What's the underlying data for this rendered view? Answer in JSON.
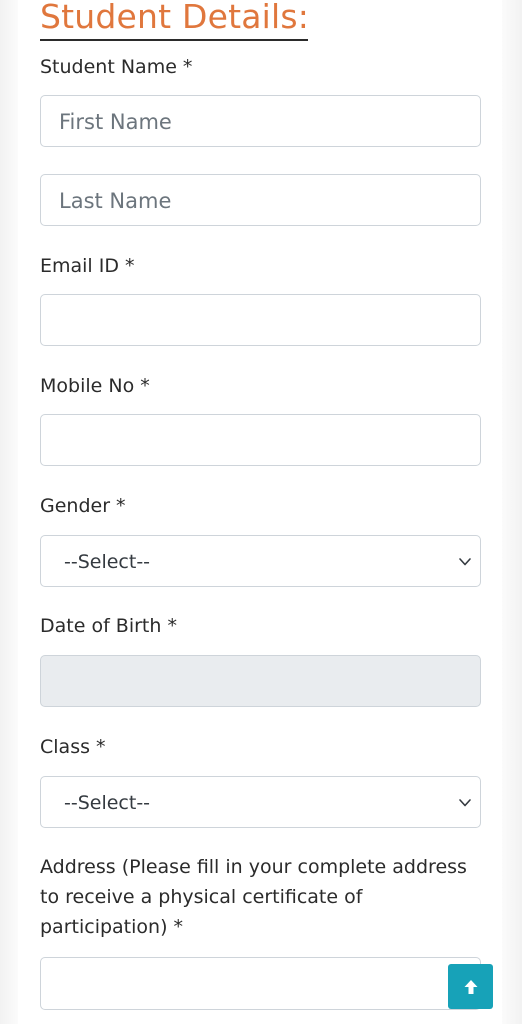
{
  "form": {
    "title": "Student Details:",
    "student_name": {
      "label": "Student Name *",
      "first_name_placeholder": "First Name",
      "last_name_placeholder": "Last Name"
    },
    "email": {
      "label": "Email ID *",
      "value": ""
    },
    "mobile": {
      "label": "Mobile No *",
      "value": ""
    },
    "gender": {
      "label": "Gender *",
      "selected": "--Select--"
    },
    "dob": {
      "label": "Date of Birth *",
      "value": ""
    },
    "class": {
      "label": "Class *",
      "selected": "--Select--"
    },
    "address": {
      "label": "Address (Please fill in your complete address to receive a physical certificate of participation) *",
      "value": ""
    }
  },
  "icons": {
    "select_chevron": "chevron-down-icon",
    "scroll_top": "arrow-up-icon"
  },
  "colors": {
    "title": "#e0773d",
    "input_border": "#ced4da",
    "disabled_bg": "#e9ecef",
    "scroll_top_button": "#17a2b8"
  }
}
